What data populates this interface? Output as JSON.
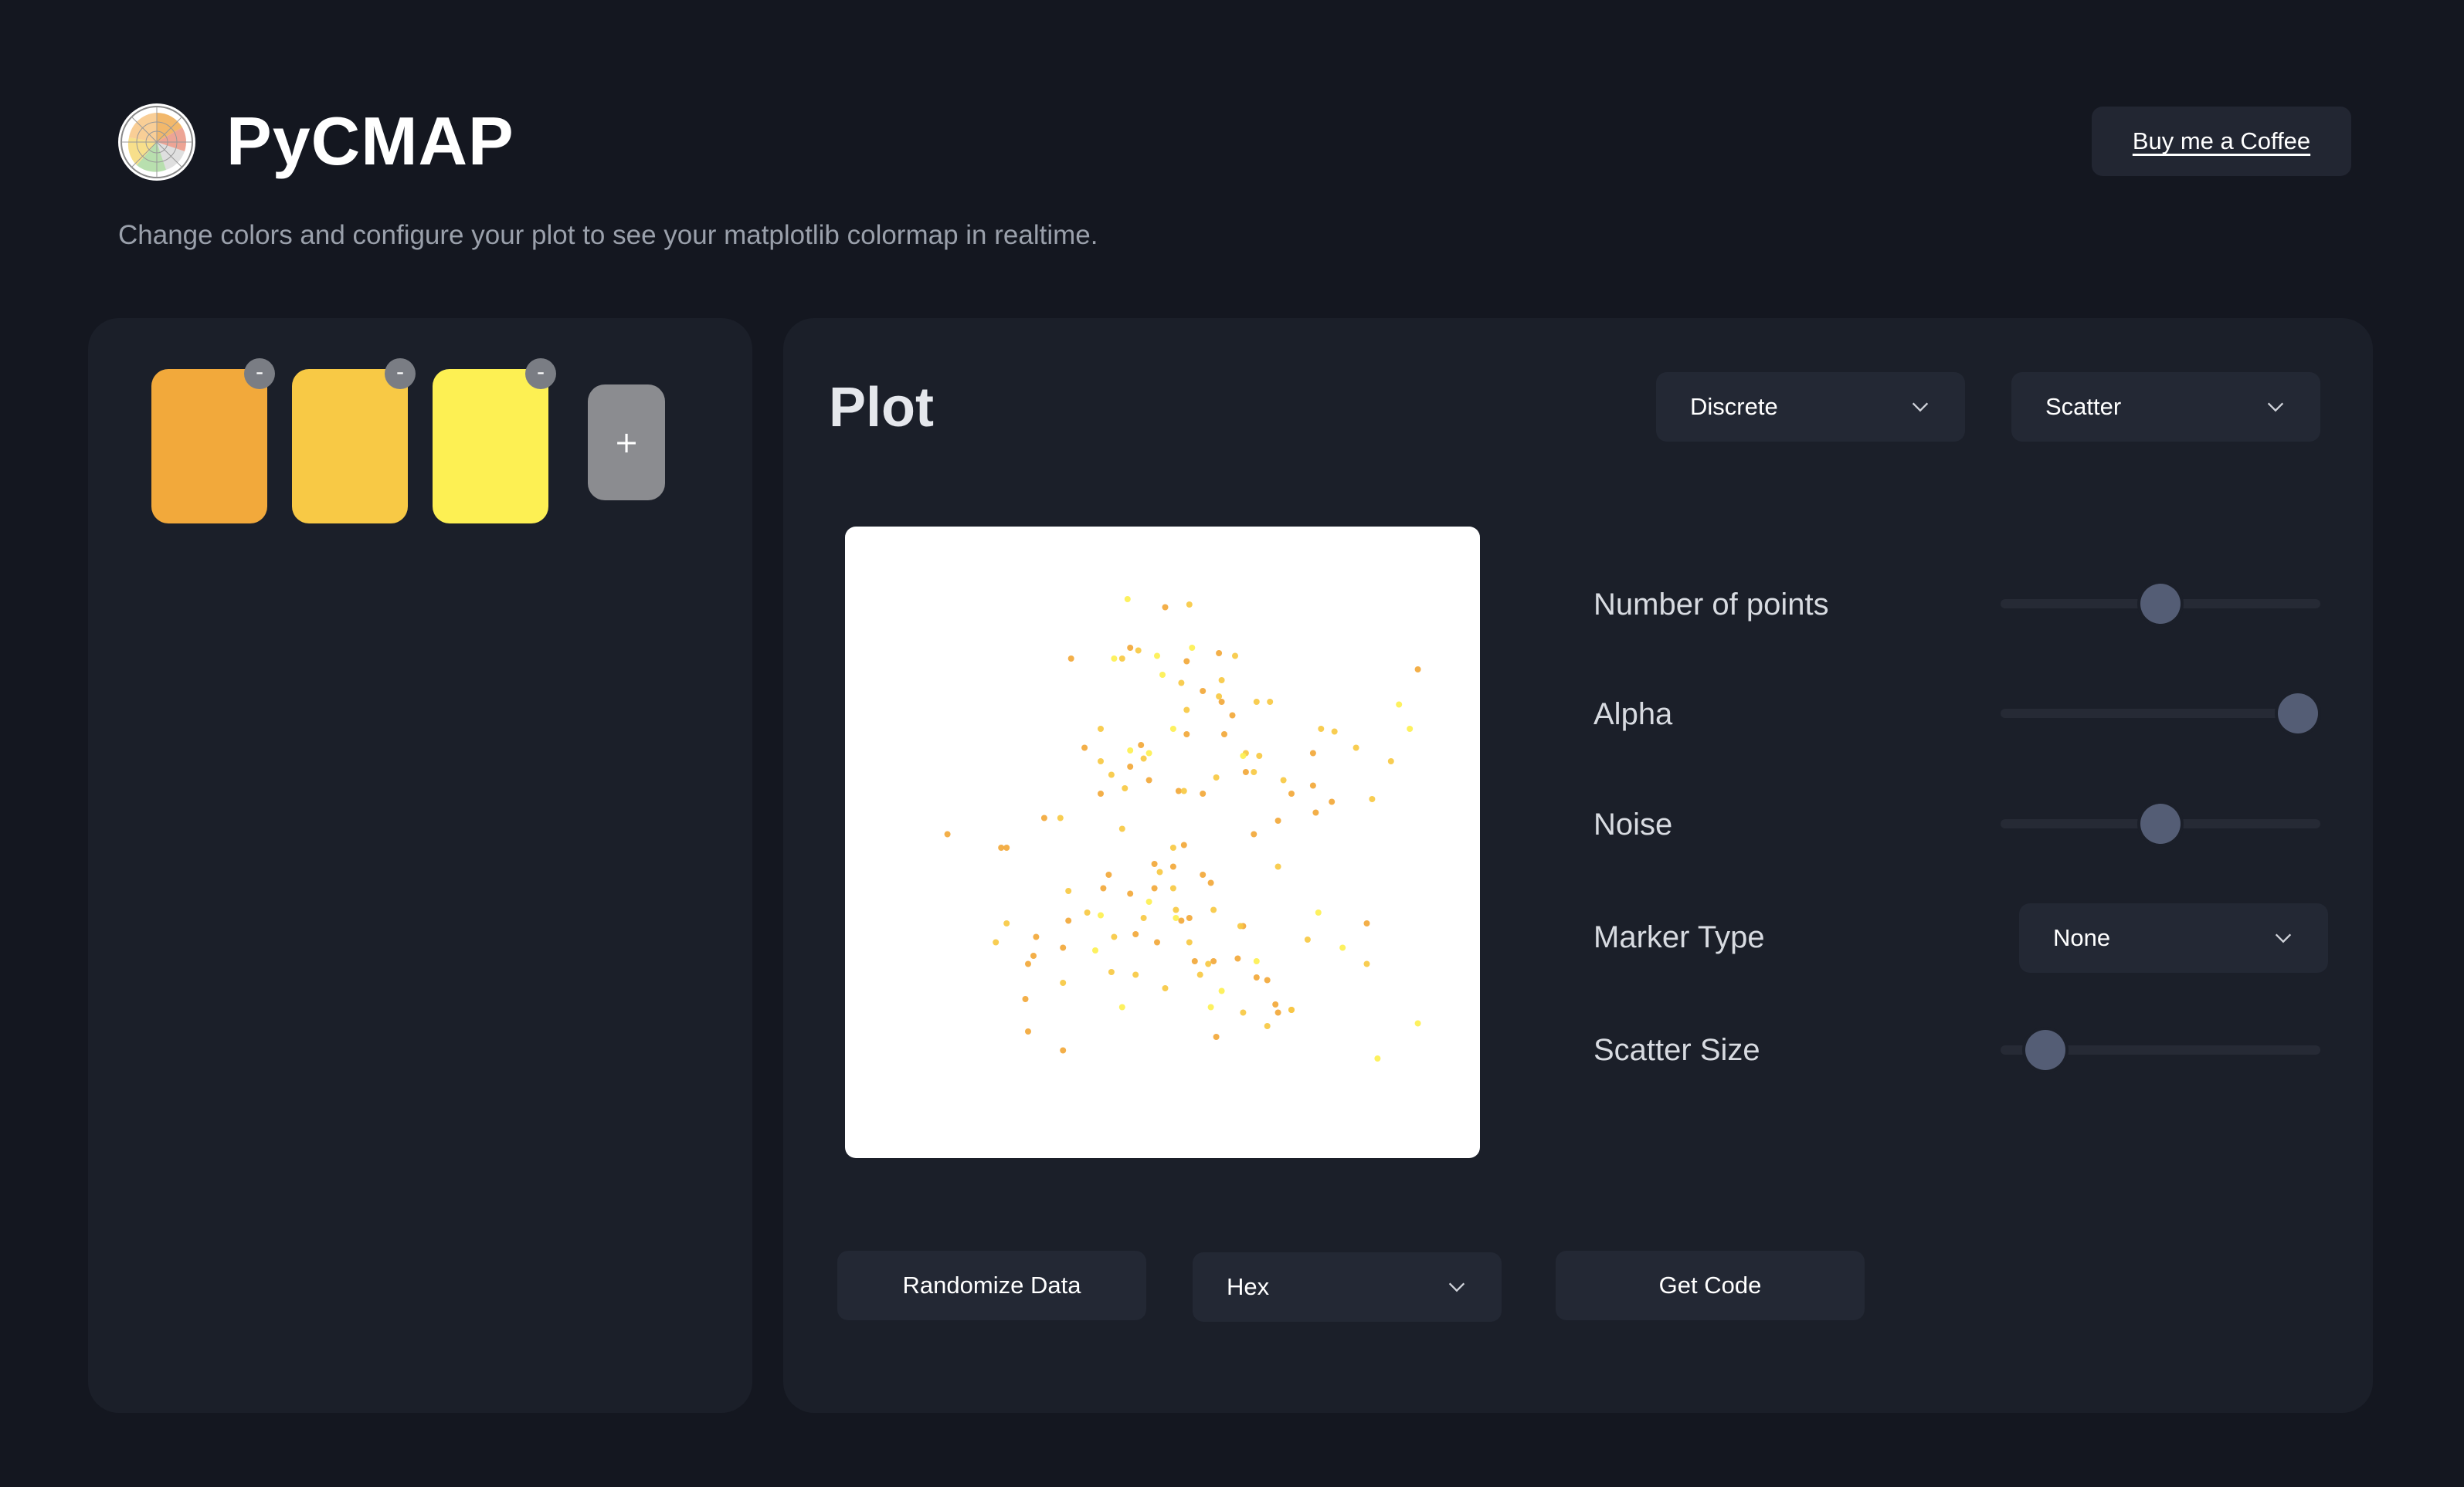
{
  "header": {
    "title": "PyCMAP",
    "subtitle": "Change colors and configure your plot to see your matplotlib colormap in realtime.",
    "coffee_label": "Buy me a Coffee"
  },
  "palette": {
    "colors": [
      "#f2a93b",
      "#f8c945",
      "#fdf053"
    ],
    "remove_label": "-",
    "add_label": "+"
  },
  "plot": {
    "heading": "Plot",
    "colormap_mode": "Discrete",
    "plot_type": "Scatter"
  },
  "controls": {
    "points_label": "Number of points",
    "points_value": 0.5,
    "alpha_label": "Alpha",
    "alpha_value": 0.93,
    "noise_label": "Noise",
    "noise_value": 0.5,
    "marker_label": "Marker Type",
    "marker_value": "None",
    "size_label": "Scatter Size",
    "size_value": 0.14
  },
  "footer": {
    "randomize_label": "Randomize Data",
    "format_value": "Hex",
    "code_label": "Get Code"
  },
  "colors": {
    "accent_thumb": "#545d75",
    "panel": "#1b1f29",
    "background": "#141720"
  },
  "chart_data": {
    "type": "scatter",
    "title": "",
    "xlabel": "",
    "ylabel": "",
    "grid": false,
    "series": [
      {
        "points": [
          [
            -0.34,
            0.68
          ],
          [
            0.01,
            0.87
          ],
          [
            0.95,
            0.64
          ],
          [
            -0.12,
            0.72
          ],
          [
            0.09,
            0.67
          ],
          [
            0.15,
            0.56
          ],
          [
            0.22,
            0.52
          ],
          [
            0.26,
            0.47
          ],
          [
            0.23,
            0.4
          ],
          [
            -0.8,
            0.03
          ],
          [
            -0.58,
            -0.02
          ],
          [
            -0.44,
            0.09
          ],
          [
            -0.29,
            0.35
          ],
          [
            -0.23,
            0.18
          ],
          [
            -0.12,
            0.28
          ],
          [
            -0.05,
            0.23
          ],
          [
            0.06,
            0.19
          ],
          [
            0.15,
            0.18
          ],
          [
            0.31,
            0.26
          ],
          [
            0.48,
            0.18
          ],
          [
            0.56,
            0.33
          ],
          [
            0.56,
            0.21
          ],
          [
            0.63,
            0.15
          ],
          [
            0.57,
            0.11
          ],
          [
            0.43,
            0.08
          ],
          [
            0.34,
            0.03
          ],
          [
            0.08,
            -0.01
          ],
          [
            -0.03,
            -0.08
          ],
          [
            -0.12,
            -0.19
          ],
          [
            -0.22,
            -0.17
          ],
          [
            -0.35,
            -0.29
          ],
          [
            -0.37,
            -0.39
          ],
          [
            -0.47,
            -0.35
          ],
          [
            -0.5,
            -0.45
          ],
          [
            -0.51,
            -0.58
          ],
          [
            -0.5,
            -0.7
          ],
          [
            -0.37,
            -0.77
          ],
          [
            -0.1,
            -0.34
          ],
          [
            -0.02,
            -0.37
          ],
          [
            0.1,
            -0.28
          ],
          [
            0.12,
            -0.44
          ],
          [
            0.19,
            -0.44
          ],
          [
            0.3,
            -0.31
          ],
          [
            0.39,
            -0.51
          ],
          [
            0.42,
            -0.6
          ],
          [
            0.48,
            -0.62
          ],
          [
            0.2,
            -0.72
          ],
          [
            0.43,
            -0.63
          ],
          [
            0.07,
            -0.29
          ],
          [
            0.15,
            -0.12
          ],
          [
            0.18,
            -0.15
          ],
          [
            0.04,
            -0.09
          ],
          [
            -0.2,
            -0.12
          ],
          [
            -0.6,
            -0.02
          ],
          [
            -0.48,
            -0.42
          ],
          [
            -0.03,
            -0.17
          ],
          [
            0.35,
            -0.5
          ],
          [
            0.28,
            -0.43
          ],
          [
            0.76,
            -0.3
          ],
          [
            0.09,
            0.4
          ],
          [
            -0.08,
            0.36
          ],
          [
            0.21,
            0.7
          ]
        ],
        "color": "#f2a93b"
      },
      {
        "points": [
          [
            0.1,
            0.88
          ],
          [
            -0.09,
            0.71
          ],
          [
            -0.15,
            0.68
          ],
          [
            0.09,
            0.49
          ],
          [
            0.36,
            0.32
          ],
          [
            0.4,
            0.52
          ],
          [
            -0.23,
            0.42
          ],
          [
            -0.38,
            0.09
          ],
          [
            -0.07,
            0.31
          ],
          [
            0.08,
            0.19
          ],
          [
            0.2,
            0.24
          ],
          [
            0.43,
            -0.09
          ],
          [
            0.59,
            0.42
          ],
          [
            0.64,
            0.41
          ],
          [
            0.72,
            0.35
          ],
          [
            -0.19,
            0.25
          ],
          [
            -0.23,
            0.3
          ],
          [
            -0.01,
            -0.11
          ],
          [
            0.04,
            -0.17
          ],
          [
            -0.28,
            -0.26
          ],
          [
            -0.18,
            -0.35
          ],
          [
            -0.07,
            -0.28
          ],
          [
            0.05,
            -0.25
          ],
          [
            0.19,
            -0.25
          ],
          [
            0.29,
            -0.31
          ],
          [
            0.3,
            -0.63
          ],
          [
            0.48,
            -0.62
          ],
          [
            0.14,
            -0.49
          ],
          [
            0.01,
            -0.54
          ],
          [
            -0.1,
            -0.49
          ],
          [
            -0.19,
            -0.48
          ],
          [
            -0.37,
            -0.52
          ],
          [
            -0.58,
            -0.3
          ],
          [
            -0.62,
            -0.37
          ],
          [
            0.04,
            -0.02
          ],
          [
            0.34,
            0.26
          ],
          [
            0.31,
            0.33
          ],
          [
            0.35,
            0.52
          ],
          [
            0.45,
            0.23
          ],
          [
            0.54,
            -0.36
          ],
          [
            0.76,
            -0.45
          ],
          [
            0.85,
            0.3
          ],
          [
            0.78,
            0.16
          ],
          [
            0.07,
            0.59
          ],
          [
            0.21,
            0.54
          ],
          [
            0.22,
            0.6
          ],
          [
            -0.14,
            0.2
          ],
          [
            0.17,
            -0.45
          ],
          [
            0.1,
            -0.37
          ],
          [
            -0.15,
            0.05
          ],
          [
            -0.35,
            -0.18
          ],
          [
            0.27,
            0.69
          ],
          [
            0.39,
            -0.68
          ]
        ],
        "color": "#f8c945"
      },
      {
        "points": [
          [
            -0.13,
            0.9
          ],
          [
            0.92,
            0.42
          ],
          [
            -0.05,
            0.33
          ],
          [
            -0.12,
            0.34
          ],
          [
            0.0,
            0.62
          ],
          [
            -0.02,
            0.69
          ],
          [
            -0.18,
            0.68
          ],
          [
            0.88,
            0.51
          ],
          [
            0.3,
            0.32
          ],
          [
            0.58,
            -0.26
          ],
          [
            0.67,
            -0.39
          ],
          [
            0.95,
            -0.67
          ],
          [
            0.8,
            -0.8
          ],
          [
            0.35,
            -0.44
          ],
          [
            0.18,
            -0.61
          ],
          [
            0.22,
            -0.55
          ],
          [
            0.05,
            -0.28
          ],
          [
            -0.05,
            -0.22
          ],
          [
            -0.15,
            -0.61
          ],
          [
            -0.23,
            -0.27
          ],
          [
            0.11,
            0.72
          ],
          [
            0.04,
            0.42
          ],
          [
            -0.25,
            -0.4
          ]
        ],
        "color": "#fdf053"
      }
    ]
  }
}
